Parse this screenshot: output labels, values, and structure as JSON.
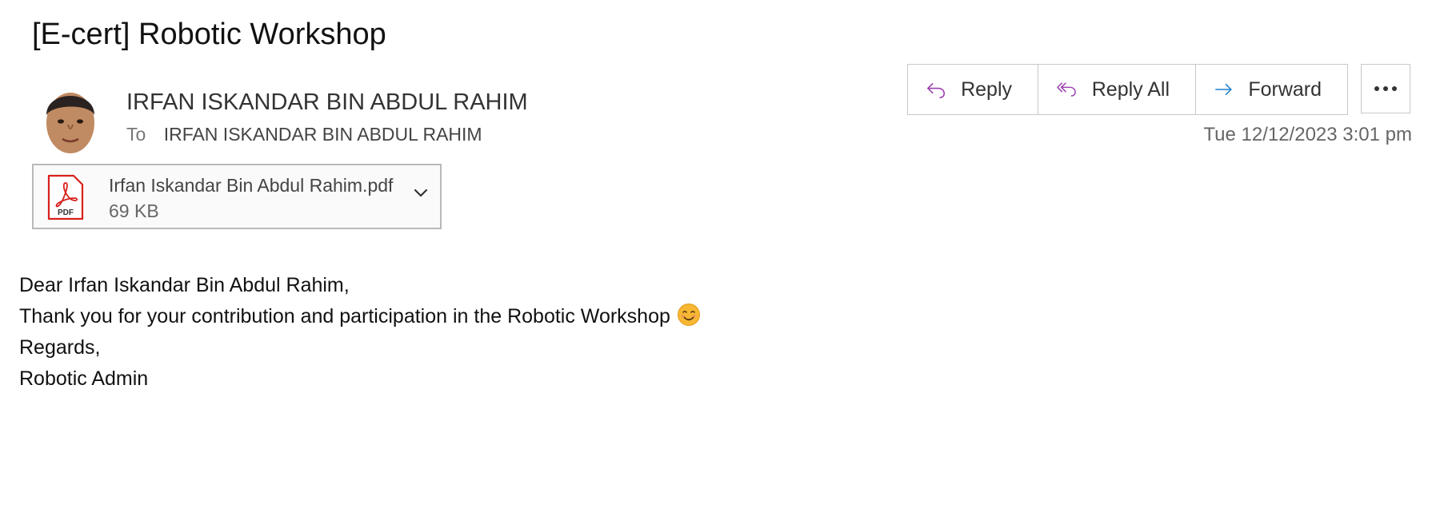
{
  "email": {
    "subject": "[E-cert] Robotic Workshop",
    "sender": "IRFAN ISKANDAR BIN ABDUL RAHIM",
    "to_label": "To",
    "recipient": "IRFAN ISKANDAR BIN ABDUL RAHIM",
    "timestamp": "Tue 12/12/2023 3:01 pm"
  },
  "actions": {
    "reply": "Reply",
    "reply_all": "Reply All",
    "forward": "Forward"
  },
  "attachment": {
    "name": "Irfan Iskandar Bin Abdul Rahim.pdf",
    "size": "69 KB",
    "type_label": "PDF"
  },
  "body": {
    "greeting": "Dear Irfan Iskandar Bin Abdul Rahim,",
    "message": "Thank you for your contribution and participation in the Robotic Workshop",
    "closing": "Regards,",
    "signature": "Robotic Admin"
  },
  "icons": {
    "reply": "reply-arrow-icon",
    "reply_all": "reply-all-icon",
    "forward": "forward-arrow-icon",
    "more": "more-dots-icon",
    "attachment": "pdf-file-icon",
    "expand": "chevron-down-icon",
    "emoji": "smiling-face-emoji"
  },
  "colors": {
    "reply_icon": "#9b3fae",
    "forward_icon": "#1f7fd0",
    "pdf_red": "#d8201c"
  }
}
